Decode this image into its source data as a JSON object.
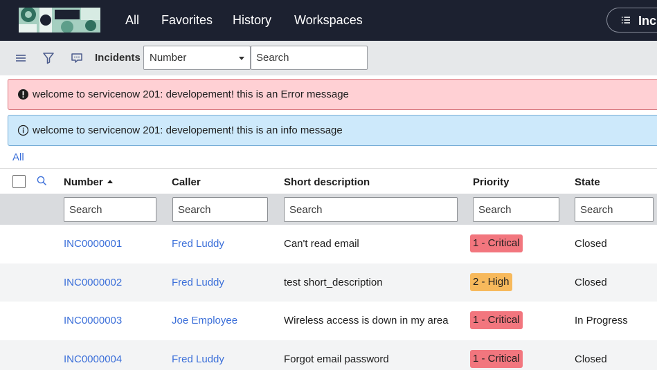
{
  "nav": {
    "items": [
      "All",
      "Favorites",
      "History",
      "Workspaces"
    ],
    "context_label": "Inci"
  },
  "toolbar": {
    "title": "Incidents",
    "field_select": "Number",
    "search_placeholder": "Search"
  },
  "messages": {
    "error": "welcome to servicenow 201: developement! this is an Error message",
    "info": "welcome to servicenow 201: developement! this is an info message"
  },
  "breadcrumb": "All",
  "table": {
    "columns": [
      "Number",
      "Caller",
      "Short description",
      "Priority",
      "State"
    ],
    "sorted_column": "Number",
    "search_placeholder": "Search",
    "rows": [
      {
        "number": "INC0000001",
        "caller": "Fred Luddy",
        "short_description": "Can't read email",
        "priority": "1 - Critical",
        "state": "Closed"
      },
      {
        "number": "INC0000002",
        "caller": "Fred Luddy",
        "short_description": "test short_description",
        "priority": "2 - High",
        "state": "Closed"
      },
      {
        "number": "INC0000003",
        "caller": "Joe Employee",
        "short_description": "Wireless access is down in my area",
        "priority": "1 - Critical",
        "state": "In Progress"
      },
      {
        "number": "INC0000004",
        "caller": "Fred Luddy",
        "short_description": "Forgot email password",
        "priority": "1 - Critical",
        "state": "Closed"
      }
    ]
  },
  "colors": {
    "nav_bg": "#1c2130",
    "link": "#3b6fd9",
    "error_bg": "#ffd0d4",
    "info_bg": "#cde9fb",
    "critical_badge": "#f2767e",
    "high_badge": "#f7b95c"
  },
  "icons": {
    "toolbar": [
      "hamburger-menu-icon",
      "filter-icon",
      "chat-icon"
    ],
    "error": "exclamation-circle-icon",
    "info": "info-circle-icon",
    "column_search": "magnifier-icon",
    "context": "list-icon"
  }
}
